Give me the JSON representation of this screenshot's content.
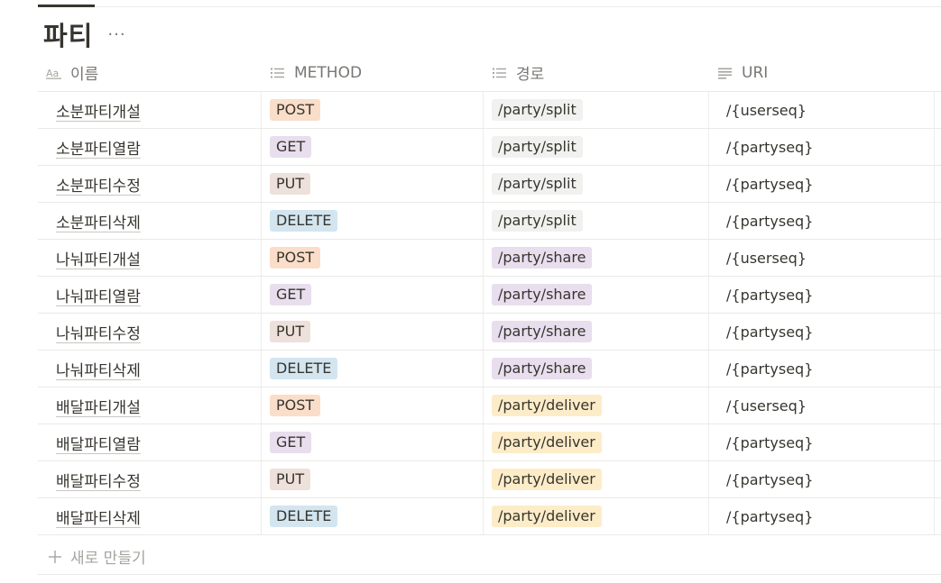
{
  "page": {
    "title": "파티",
    "more_label": "···"
  },
  "columns": [
    {
      "label": "이름",
      "icon": "title-property-icon"
    },
    {
      "label": "METHOD",
      "icon": "list-property-icon"
    },
    {
      "label": "경로",
      "icon": "list-property-icon"
    },
    {
      "label": "URI",
      "icon": "text-property-icon"
    }
  ],
  "colors": {
    "POST": "#fadec9",
    "GET": "#e8deee",
    "PUT": "#eee0da",
    "DELETE": "#d3e5ef",
    "/party/split": "#f1f1ef",
    "/party/share": "#e8deee",
    "/party/deliver": "#fdecc8"
  },
  "rows": [
    {
      "name": "소분파티개설",
      "method": "POST",
      "path": "/party/split",
      "uri": "/{userseq}"
    },
    {
      "name": "소분파티열람",
      "method": "GET",
      "path": "/party/split",
      "uri": "/{partyseq}"
    },
    {
      "name": "소분파티수정",
      "method": "PUT",
      "path": "/party/split",
      "uri": "/{partyseq}"
    },
    {
      "name": "소분파티삭제",
      "method": "DELETE",
      "path": "/party/split",
      "uri": "/{partyseq}"
    },
    {
      "name": "나눠파티개설",
      "method": "POST",
      "path": "/party/share",
      "uri": "/{userseq}"
    },
    {
      "name": "나눠파티열람",
      "method": "GET",
      "path": "/party/share",
      "uri": "/{partyseq}"
    },
    {
      "name": "나눠파티수정",
      "method": "PUT",
      "path": "/party/share",
      "uri": "/{partyseq}"
    },
    {
      "name": "나눠파티삭제",
      "method": "DELETE",
      "path": "/party/share",
      "uri": "/{partyseq}"
    },
    {
      "name": "배달파티개설",
      "method": "POST",
      "path": "/party/deliver",
      "uri": "/{userseq}"
    },
    {
      "name": "배달파티열람",
      "method": "GET",
      "path": "/party/deliver",
      "uri": "/{partyseq}"
    },
    {
      "name": "배달파티수정",
      "method": "PUT",
      "path": "/party/deliver",
      "uri": "/{partyseq}"
    },
    {
      "name": "배달파티삭제",
      "method": "DELETE",
      "path": "/party/deliver",
      "uri": "/{partyseq}"
    }
  ],
  "new_row": {
    "label": "새로 만들기",
    "icon": "plus-icon"
  }
}
